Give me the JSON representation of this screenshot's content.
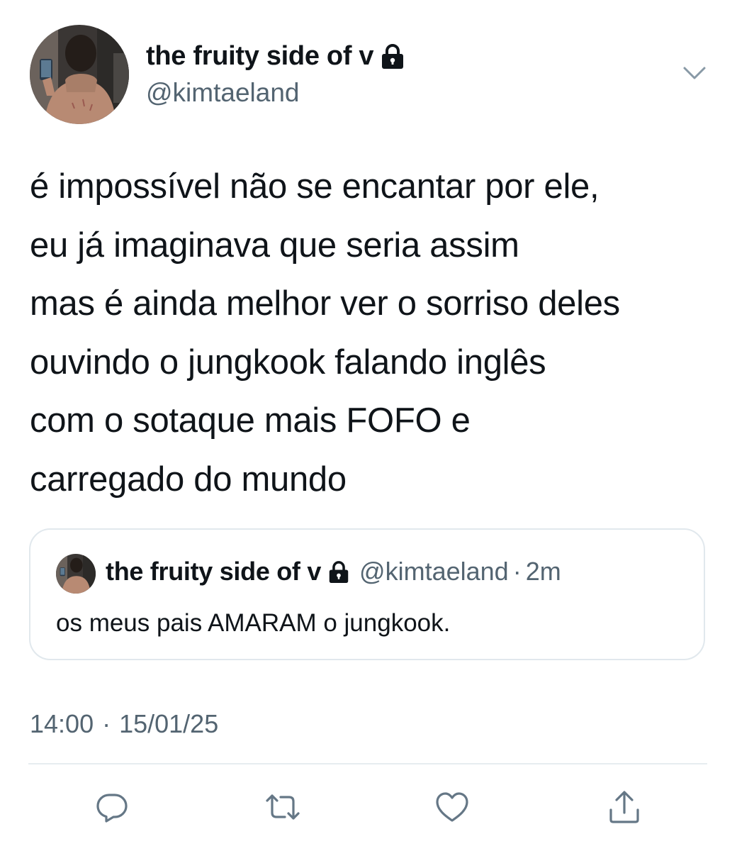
{
  "author": {
    "display_name": "the fruity side of v",
    "handle": "@kimtaeland",
    "protected_icon": "lock-icon",
    "menu_icon": "chevron-down-icon"
  },
  "tweet": {
    "lines": [
      "é impossível não se encantar por ele,",
      "eu já imaginava que seria assim",
      "mas é ainda melhor ver o sorriso deles",
      "ouvindo o jungkook falando inglês",
      "com o sotaque mais FOFO e",
      "carregado do mundo"
    ]
  },
  "quoted_tweet": {
    "display_name": "the fruity side of v",
    "handle": "@kimtaeland",
    "separator": "·",
    "relative_time": "2m",
    "text": "os meus pais AMARAM o jungkook."
  },
  "meta": {
    "time": "14:00",
    "separator": "·",
    "date": "15/01/25"
  },
  "actions": [
    {
      "name": "reply",
      "icon": "reply-icon"
    },
    {
      "name": "retweet",
      "icon": "retweet-icon"
    },
    {
      "name": "like",
      "icon": "heart-icon"
    },
    {
      "name": "share",
      "icon": "share-icon"
    }
  ],
  "colors": {
    "text_primary": "#0f1419",
    "text_secondary": "#536471",
    "border": "#e1e8ed"
  }
}
